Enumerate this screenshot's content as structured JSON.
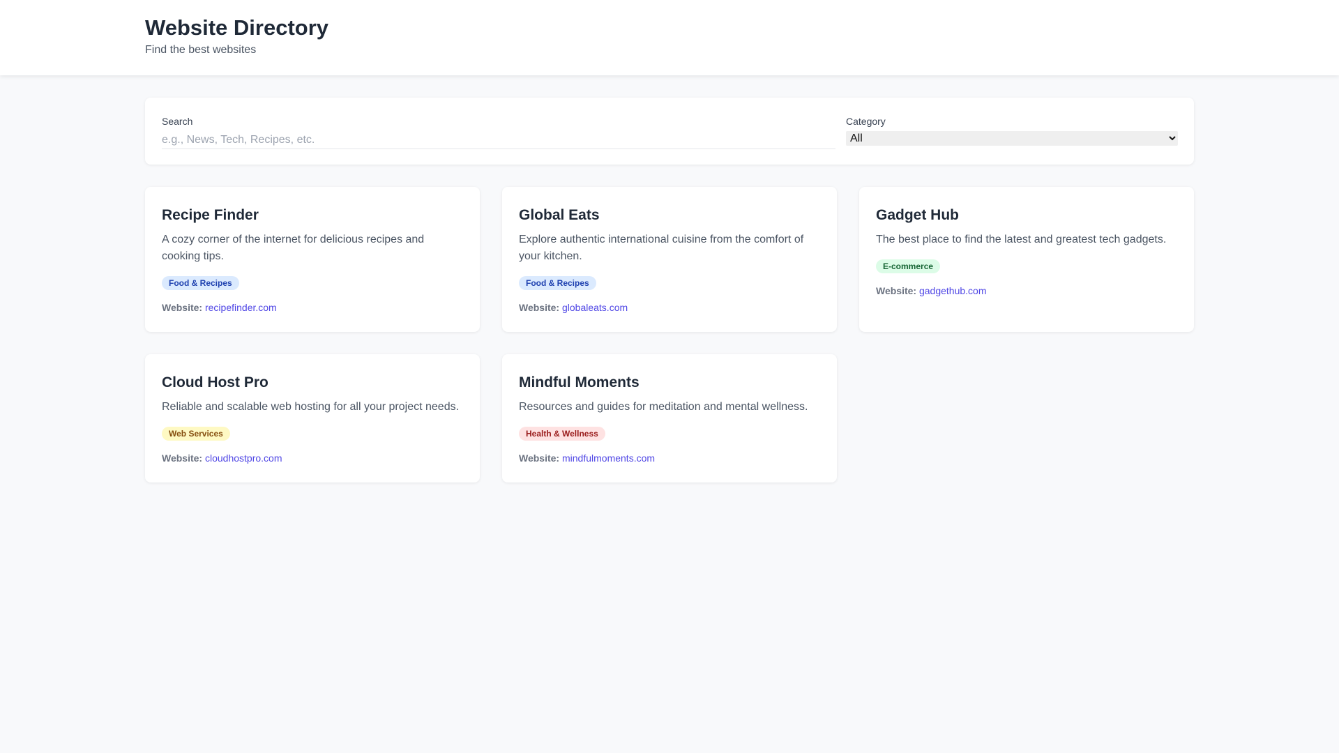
{
  "header": {
    "title": "Website Directory",
    "subtitle": "Find the best websites"
  },
  "filters": {
    "search_label": "Search",
    "search_placeholder": "e.g., News, Tech, Recipes, etc.",
    "search_value": "",
    "category_label": "Category",
    "category_selected": "All"
  },
  "website_label": "Website:",
  "cards": [
    {
      "title": "Recipe Finder",
      "description": "A cozy corner of the internet for delicious recipes and cooking tips.",
      "category": "Food & Recipes",
      "category_bg": "#dbeafe",
      "category_color": "#1e40af",
      "website": "recipefinder.com"
    },
    {
      "title": "Global Eats",
      "description": "Explore authentic international cuisine from the comfort of your kitchen.",
      "category": "Food & Recipes",
      "category_bg": "#dbeafe",
      "category_color": "#1e40af",
      "website": "globaleats.com"
    },
    {
      "title": "Gadget Hub",
      "description": "The best place to find the latest and greatest tech gadgets.",
      "category": "E-commerce",
      "category_bg": "#dcfce7",
      "category_color": "#166534",
      "website": "gadgethub.com"
    },
    {
      "title": "Cloud Host Pro",
      "description": "Reliable and scalable web hosting for all your project needs.",
      "category": "Web Services",
      "category_bg": "#fef9c3",
      "category_color": "#854d0e",
      "website": "cloudhostpro.com"
    },
    {
      "title": "Mindful Moments",
      "description": "Resources and guides for meditation and mental wellness.",
      "category": "Health & Wellness",
      "category_bg": "#fee2e2",
      "category_color": "#991b1b",
      "website": "mindfulmoments.com"
    }
  ]
}
